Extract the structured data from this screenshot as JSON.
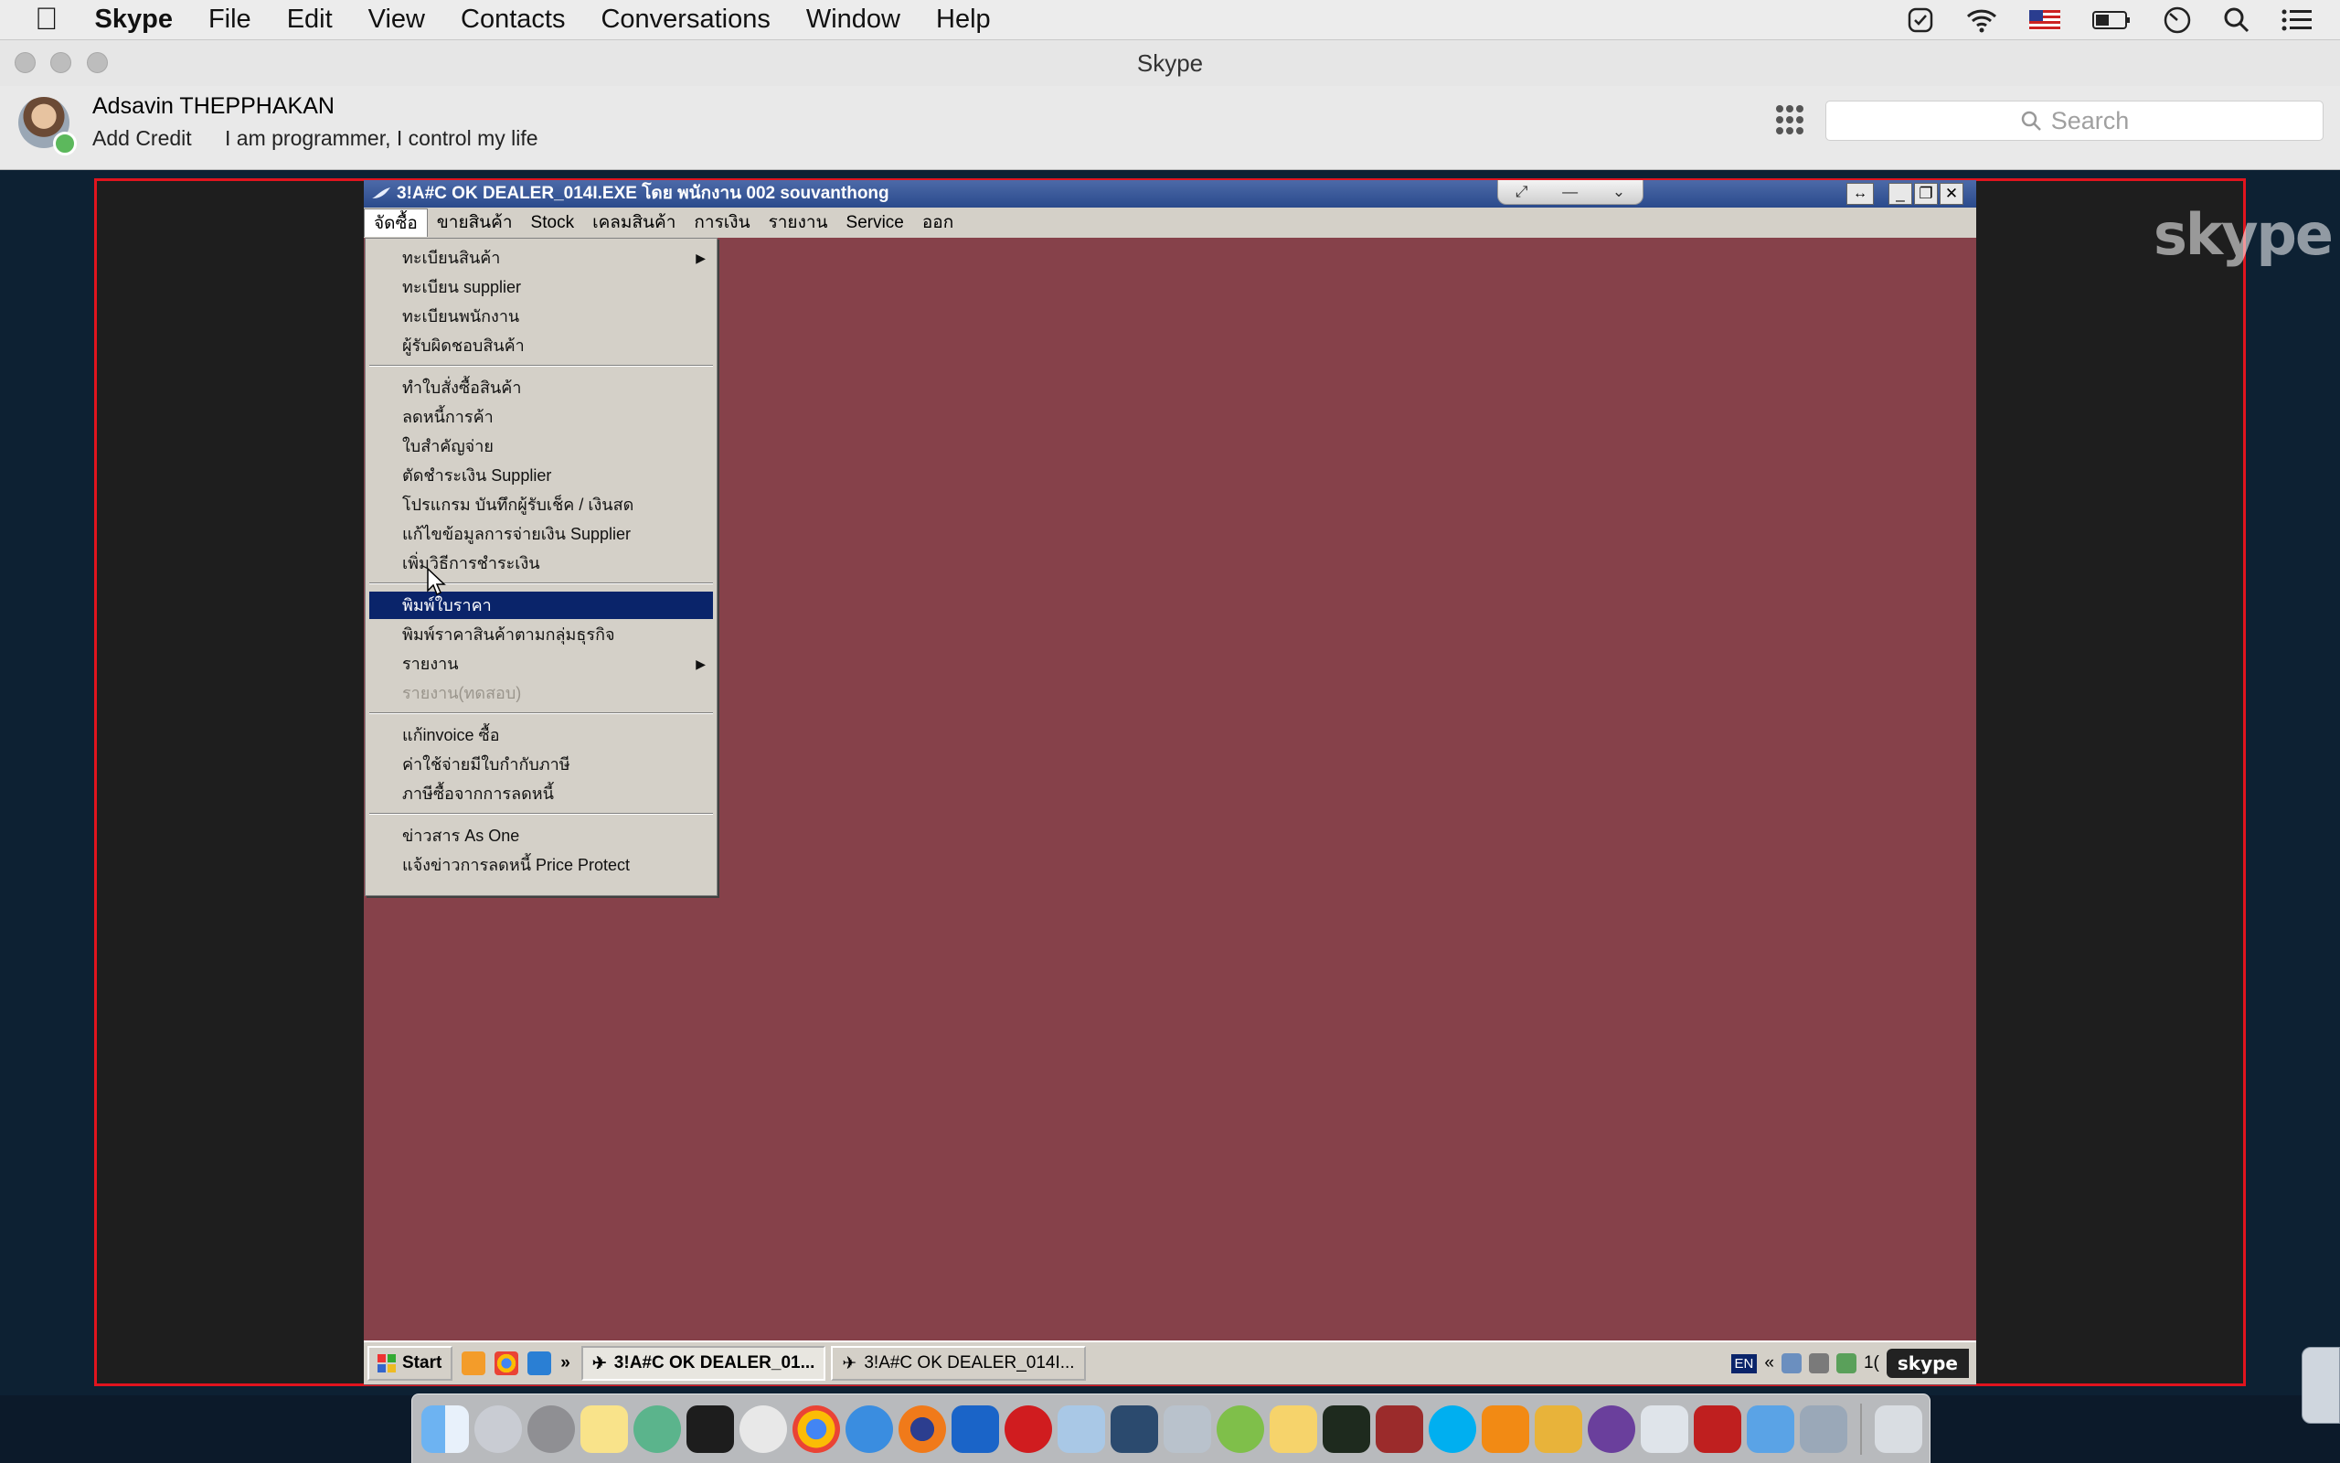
{
  "menubar": {
    "app_name": "Skype",
    "items": [
      "File",
      "Edit",
      "View",
      "Contacts",
      "Conversations",
      "Window",
      "Help"
    ]
  },
  "window": {
    "title": "Skype"
  },
  "profile": {
    "name": "Adsavin THEPPHAKAN",
    "add_credit": "Add Credit",
    "mood": "I am programmer, I control my life"
  },
  "search": {
    "placeholder": "Search"
  },
  "remote": {
    "title": "3!A#C OK DEALER_014I.EXE โดย พนักงาน 002 souvanthong",
    "menu": [
      "จัดซื้อ",
      "ขายสินค้า",
      "Stock",
      "เคลมสินค้า",
      "การเงิน",
      "รายงาน",
      "Service",
      "ออก"
    ],
    "dropdown": [
      {
        "label": "ทะเบียนสินค้า",
        "submenu": true
      },
      {
        "label": "ทะเบียน supplier"
      },
      {
        "label": "ทะเบียนพนักงาน"
      },
      {
        "label": "ผู้รับผิดชอบสินค้า"
      },
      {
        "label": "ทำใบสั่งซื้อสินค้า"
      },
      {
        "label": "ลดหนี้การค้า"
      },
      {
        "label": "ใบสำคัญจ่าย"
      },
      {
        "label": "ตัดชำระเงิน Supplier"
      },
      {
        "label": "โปรแกรม บันทึกผู้รับเช็ค / เงินสด"
      },
      {
        "label": "แก้ไขข้อมูลการจ่ายเงิน Supplier"
      },
      {
        "label": "เพิ่มวิธีการชำระเงิน"
      },
      {
        "label": "พิมพ์ใบราคา",
        "selected": true
      },
      {
        "label": "พิมพ์ราคาสินค้าตามกลุ่มธุรกิจ"
      },
      {
        "label": "รายงาน",
        "submenu": true
      },
      {
        "label": "รายงาน(ทดสอบ)",
        "disabled": true
      },
      {
        "label": "แก้invoice ซื้อ"
      },
      {
        "label": "ค่าใช้จ่ายมีใบกำกับภาษี"
      },
      {
        "label": "ภาษีซื้อจากการลดหนี้"
      },
      {
        "label": "ข่าวสาร As One"
      },
      {
        "label": "แจ้งข่าวการลดหนี้ Price Protect"
      }
    ],
    "taskbar": {
      "start": "Start",
      "tasks": [
        "3!A#C OK DEALER_01...",
        "3!A#C OK DEALER_014I..."
      ],
      "lang": "EN",
      "clock_partial": "1(",
      "skype_badge": "skype"
    }
  },
  "watermark": "skype",
  "colors": {
    "remote_desktop": "#86414a",
    "share_border": "#e0141e",
    "menu_selected": "#0a246a"
  },
  "dock_icons": [
    "finder-icon",
    "launchpad-icon",
    "system-preferences-icon",
    "notes-icon",
    "atom-icon",
    "terminal-icon",
    "sequel-pro-icon",
    "chrome-icon",
    "safari-icon",
    "firefox-icon",
    "teamviewer-icon",
    "opera-icon",
    "virtualbox-icon",
    "mysql-workbench-icon",
    "database-icon",
    "android-studio-icon",
    "stickies-icon",
    "activity-monitor-icon",
    "dictionary-icon",
    "skype-icon",
    "vlc-icon",
    "sublime-icon",
    "github-icon",
    "wifi-explorer-icon",
    "filezilla-icon",
    "xcode-icon",
    "preview-icon",
    "trash-icon"
  ]
}
